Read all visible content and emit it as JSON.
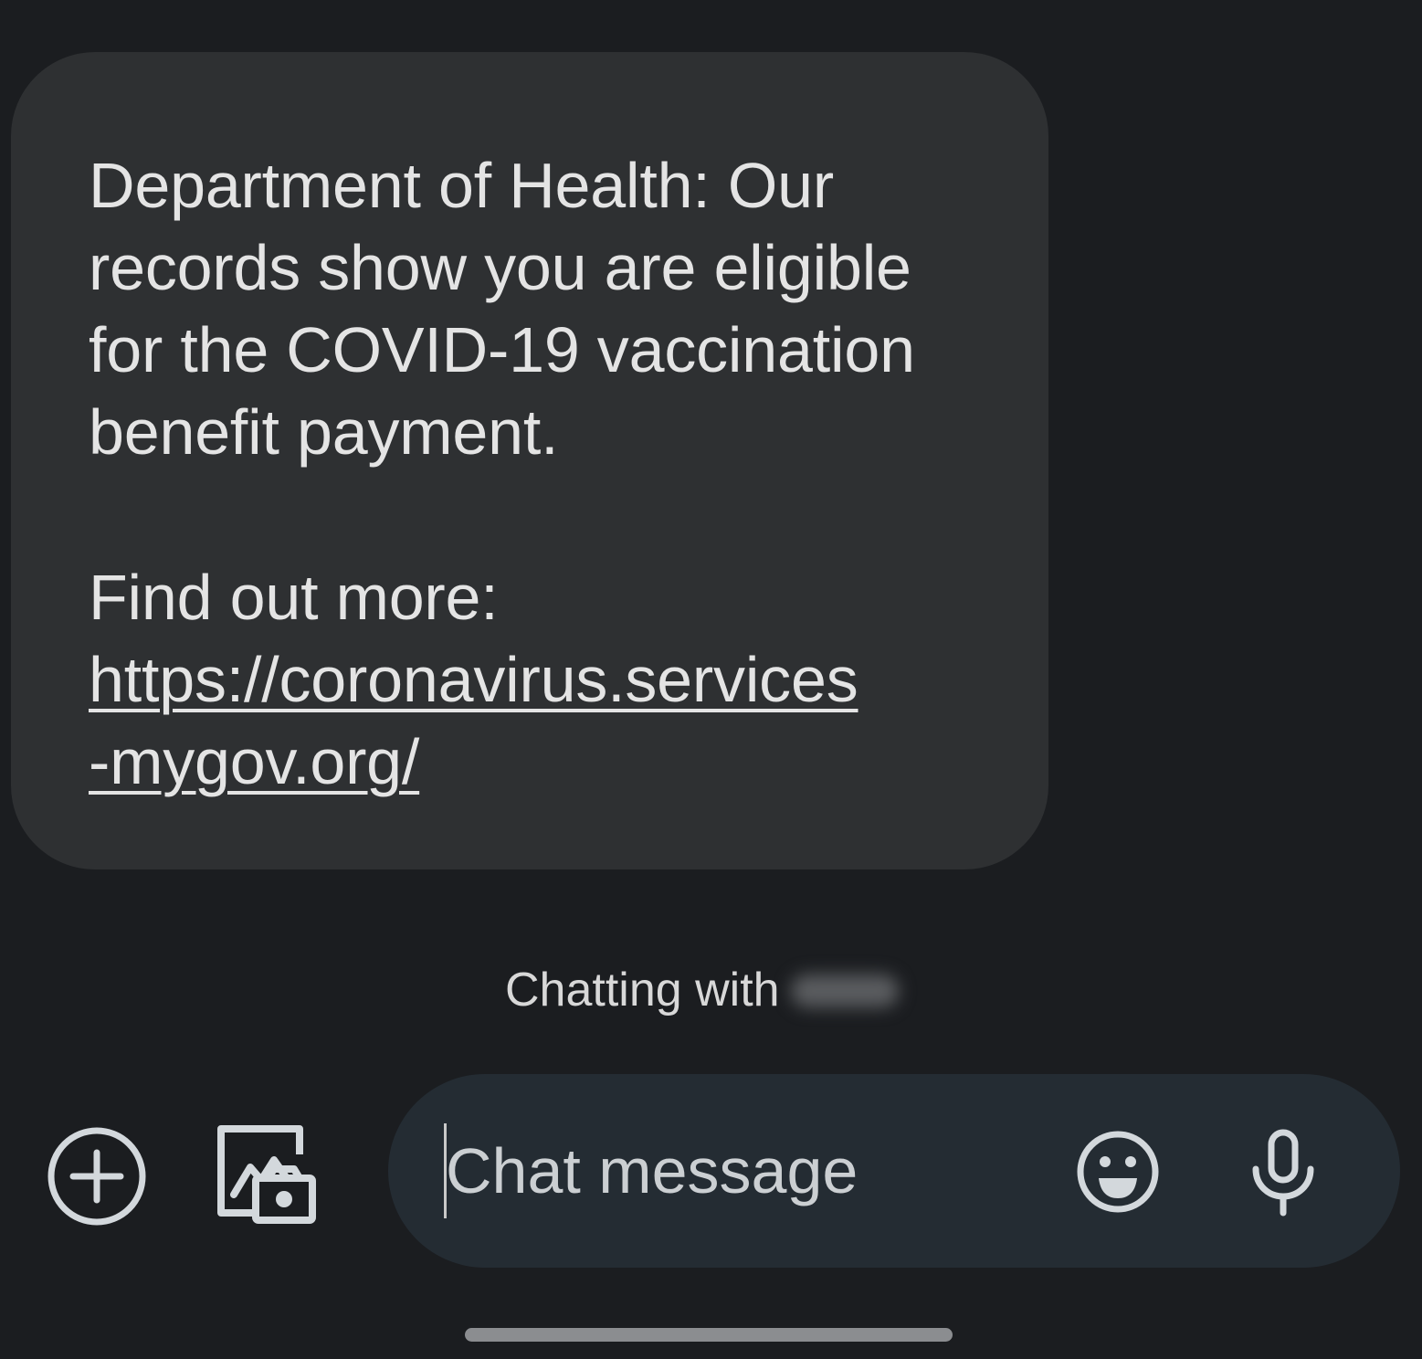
{
  "message": {
    "lines": [
      "Department of Health: Our",
      "records show you are eligible",
      "for the COVID-19 vaccination",
      "benefit payment."
    ],
    "find_out_more": "Find out more:",
    "link_lines": [
      "https://coronavirus.services",
      "-mygov.org/"
    ]
  },
  "chatting_with": {
    "label": "Chatting with"
  },
  "compose": {
    "placeholder": "Chat message",
    "value": ""
  },
  "icons": {
    "add": "add-circle-icon",
    "gallery": "gallery-camera-icon",
    "emoji": "emoji-icon",
    "mic": "microphone-icon"
  },
  "colors": {
    "background": "#1b1d20",
    "bubble": "#2e3032",
    "compose_bar": "#242c33",
    "text": "#e4e4e4",
    "icon": "#d3d8dc"
  }
}
